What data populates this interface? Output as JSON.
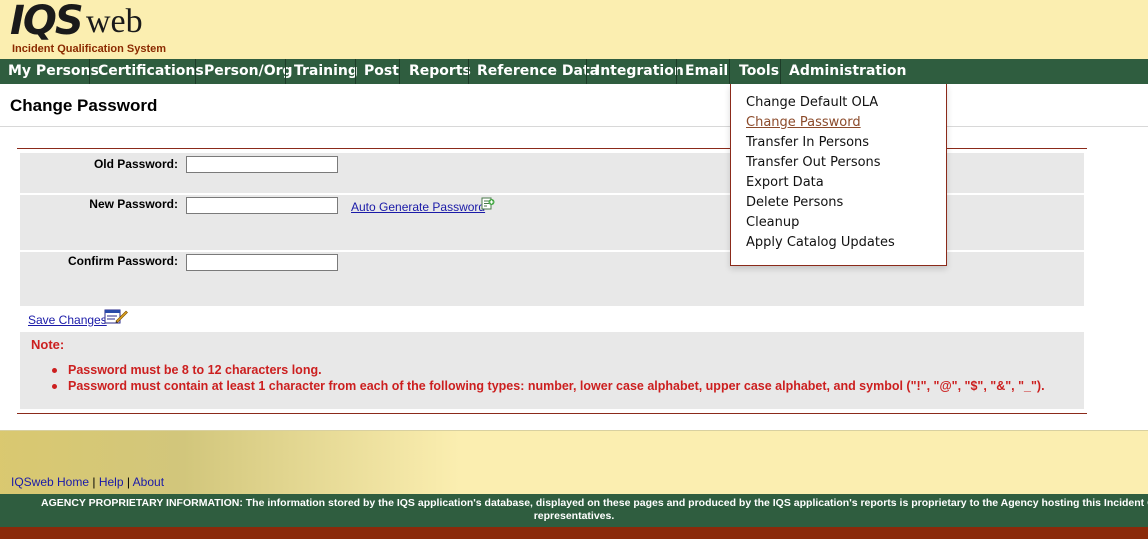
{
  "logo": {
    "iqs": "IQS",
    "web": "web",
    "subtitle": "Incident Qualification System"
  },
  "nav": {
    "items": [
      {
        "label": "My Persons"
      },
      {
        "label": "Certifications"
      },
      {
        "label": "Person/Org"
      },
      {
        "label": "Training"
      },
      {
        "label": "Post"
      },
      {
        "label": "Reports"
      },
      {
        "label": "Reference Data"
      },
      {
        "label": "Integration"
      },
      {
        "label": "Email"
      },
      {
        "label": "Tools"
      },
      {
        "label": "Administration"
      }
    ]
  },
  "page": {
    "title": "Change Password"
  },
  "form": {
    "old_password_label": "Old Password:",
    "new_password_label": "New Password:",
    "confirm_password_label": "Confirm Password:",
    "old_password_value": "",
    "new_password_value": "",
    "confirm_password_value": "",
    "auto_generate_label": "Auto Generate Password",
    "save_label": "Save Changes"
  },
  "note": {
    "title": "Note:",
    "items": [
      "Password must be 8 to 12 characters long.",
      "Password must contain at least 1 character from each of the following types: number, lower case alphabet, upper case alphabet, and symbol (\"!\", \"@\", \"$\", \"&\", \"_\")."
    ]
  },
  "tools_menu": {
    "items": [
      {
        "label": "Change Default OLA"
      },
      {
        "label": "Change Password"
      },
      {
        "label": "Transfer In Persons"
      },
      {
        "label": "Transfer Out Persons"
      },
      {
        "label": "Export Data"
      },
      {
        "label": "Delete Persons"
      },
      {
        "label": "Cleanup"
      },
      {
        "label": "Apply Catalog Updates"
      }
    ]
  },
  "footer": {
    "home": "IQSweb Home",
    "help": "Help",
    "about": "About",
    "separator": "|",
    "proprietary_line1": "AGENCY PROPRIETARY INFORMATION: The information stored by the IQS application's database, displayed on these pages and produced by the IQS application's reports is proprietary to the Agency hosting this Incident Q",
    "proprietary_line2": "representatives."
  },
  "colors": {
    "nav_bg": "#2f5d3f",
    "header_bg": "#fbeeb0",
    "note_red": "#cc1f1f",
    "border_brown": "#8b2a1a",
    "link_blue": "#1a1aa8"
  }
}
